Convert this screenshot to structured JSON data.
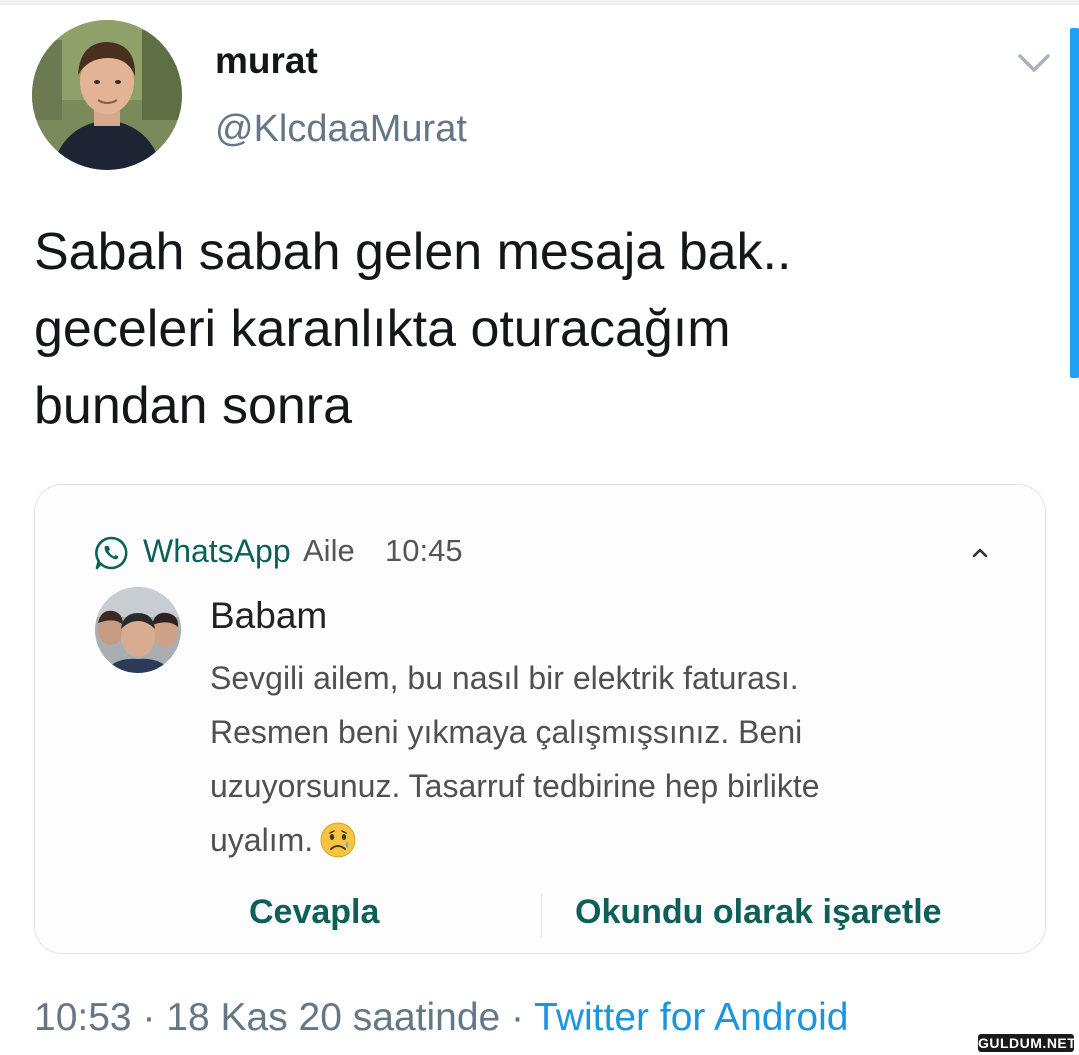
{
  "tweet": {
    "display_name": "murat",
    "handle": "@KlcdaaMurat",
    "text_lines": [
      "Sabah sabah gelen mesaja bak..",
      "geceleri karanlıkta oturacağım",
      "bundan sonra"
    ],
    "time": "10:53",
    "separator": " · ",
    "date": "18 Kas 20 saatinde",
    "source": "Twitter for Android"
  },
  "notification": {
    "app": "WhatsApp",
    "group": "Aile",
    "time": "10:45",
    "sender": "Babam",
    "message_lines": [
      "Sevgili ailem, bu nasıl bir elektrik faturası.",
      "Resmen beni yıkmaya çalışmışsınız. Beni",
      "uzuyorsunuz. Tasarruf tedbirine hep birlikte",
      "uyalım."
    ],
    "reply_label": "Cevapla",
    "mark_read_label": "Okundu olarak işaretle"
  },
  "icons": {
    "menu": "chevron-down-icon",
    "app": "whatsapp-icon",
    "expand": "chevron-up-icon",
    "emoji": "sad-face-emoji-icon"
  },
  "colors": {
    "whatsapp_green": "#0b6157",
    "twitter_blue": "#1b95e0",
    "secondary_text": "#657786"
  },
  "watermark": "GULDUM.NET"
}
